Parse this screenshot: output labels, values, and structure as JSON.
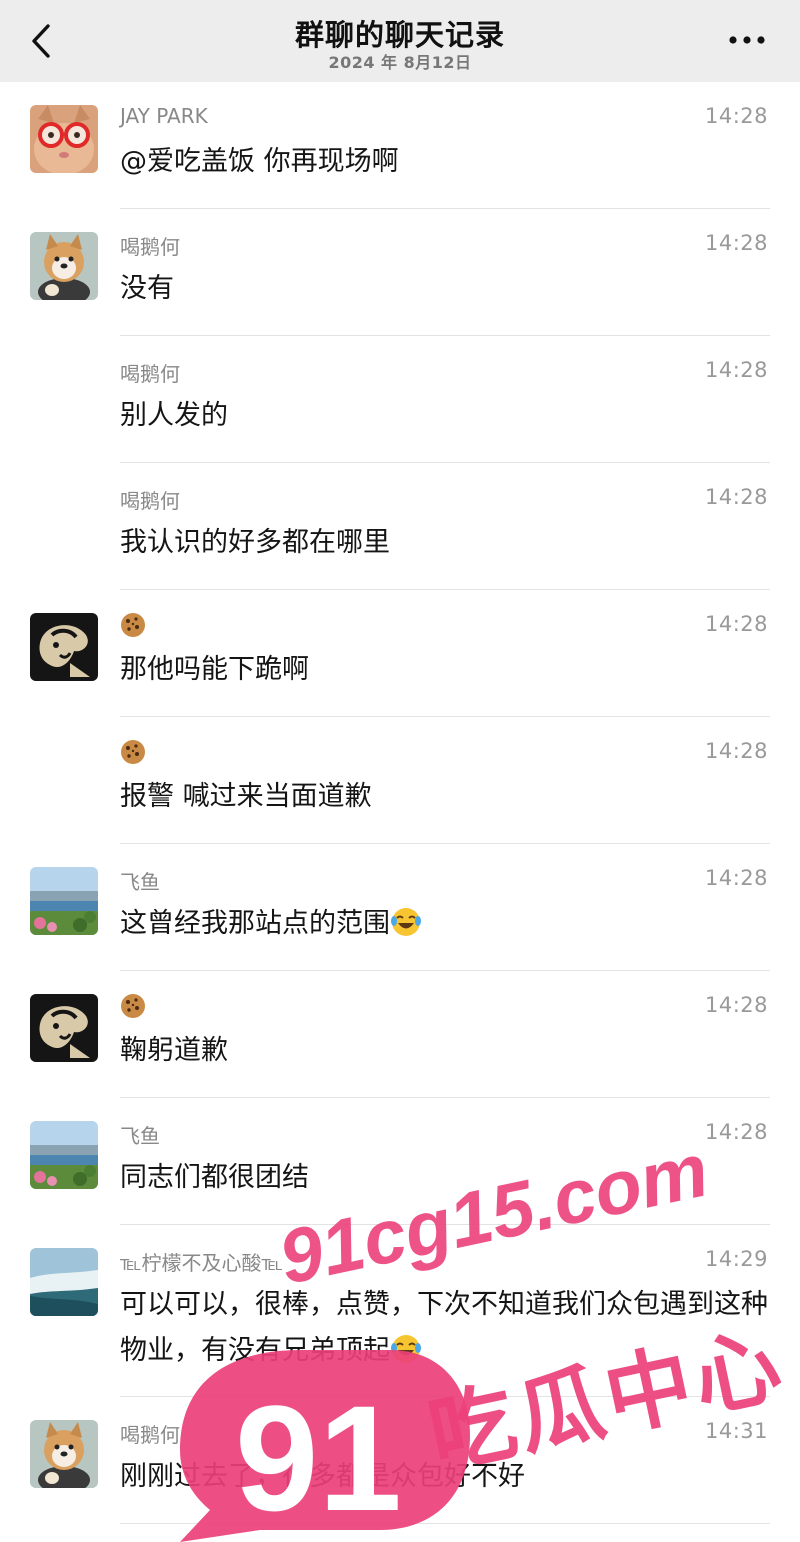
{
  "header": {
    "title": "群聊的聊天记录",
    "date": "2024 年 8月12日"
  },
  "messages": [
    {
      "sender": "JAY PARK",
      "time": "14:28",
      "text": "@爱吃盖饭 你再现场啊",
      "avatar": "cat-glasses"
    },
    {
      "sender": "喝鹅何",
      "time": "14:28",
      "text": "没有",
      "avatar": "shiba"
    },
    {
      "sender": "喝鹅何",
      "time": "14:28",
      "text": "别人发的",
      "avatar": ""
    },
    {
      "sender": "喝鹅何",
      "time": "14:28",
      "text": "我认识的好多都在哪里",
      "avatar": ""
    },
    {
      "sender": "",
      "sender_icon": "cookie-icon",
      "time": "14:28",
      "text": "那他吗能下跪啊",
      "avatar": "dark-sketch"
    },
    {
      "sender": "",
      "sender_icon": "cookie-icon",
      "time": "14:28",
      "text": "报警 喊过来当面道歉",
      "avatar": ""
    },
    {
      "sender": "飞鱼",
      "time": "14:28",
      "text": "这曾经我那站点的范围",
      "trailing_emoji": "laughing-crying-emoji",
      "avatar": "landscape"
    },
    {
      "sender": "",
      "sender_icon": "cookie-icon",
      "time": "14:28",
      "text": "鞠躬道歉",
      "avatar": "dark-sketch"
    },
    {
      "sender": "飞鱼",
      "time": "14:28",
      "text": "同志们都很团结",
      "avatar": "landscape"
    },
    {
      "sender": "℡柠檬不及心酸℡",
      "time": "14:29",
      "text": "可以可以，很棒，点赞，下次不知道我们众包遇到这种物业，有没有兄弟顶起",
      "trailing_emoji": "laughing-crying-emoji",
      "avatar": "waterfall"
    },
    {
      "sender": "喝鹅何",
      "time": "14:31",
      "text": "刚刚过去了，很多都是众包好不好",
      "avatar": "shiba"
    }
  ],
  "watermark": {
    "url": "91cg15.com",
    "number": "91",
    "text": "吃瓜中心"
  },
  "colors": {
    "navbar_bg": "#ededed",
    "divider": "#e3e3e3",
    "watermark": "#ec407a"
  }
}
